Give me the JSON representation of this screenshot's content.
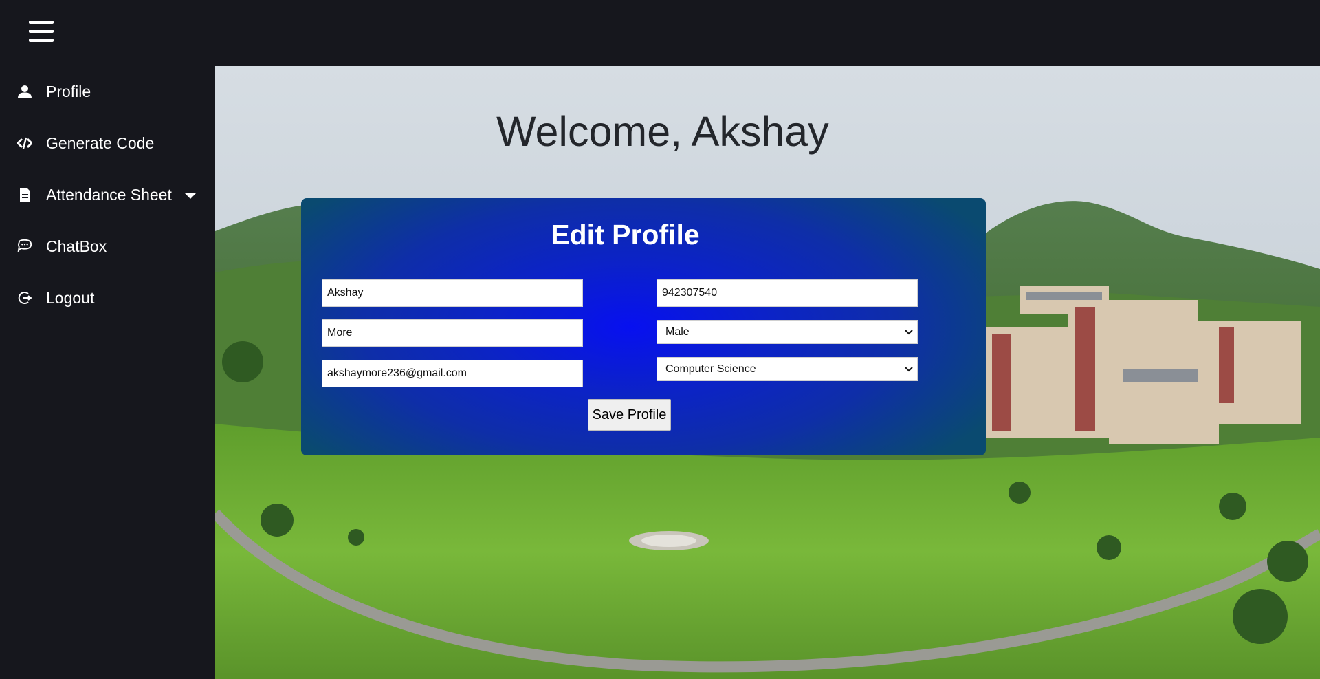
{
  "header": {
    "menu_icon": "hamburger-menu-icon"
  },
  "sidebar": {
    "items": [
      {
        "label": "Profile",
        "icon": "user-icon"
      },
      {
        "label": "Generate Code",
        "icon": "code-icon"
      },
      {
        "label": "Attendance Sheet",
        "icon": "document-icon",
        "has_dropdown": true
      },
      {
        "label": "ChatBox",
        "icon": "chat-bubble-icon"
      },
      {
        "label": "Logout",
        "icon": "logout-icon"
      }
    ]
  },
  "main": {
    "welcome_text": "Welcome, Akshay",
    "edit_profile": {
      "title": "Edit Profile",
      "first_name": "Akshay",
      "last_name": "More",
      "email": "akshaymore236@gmail.com",
      "phone": "942307540",
      "gender": "Male",
      "department": "Computer Science",
      "save_label": "Save Profile"
    }
  },
  "colors": {
    "sidebar_bg": "#16171d",
    "card_center": "#0710f0",
    "card_edge": "#0a4a70",
    "text_light": "#ffffff"
  }
}
